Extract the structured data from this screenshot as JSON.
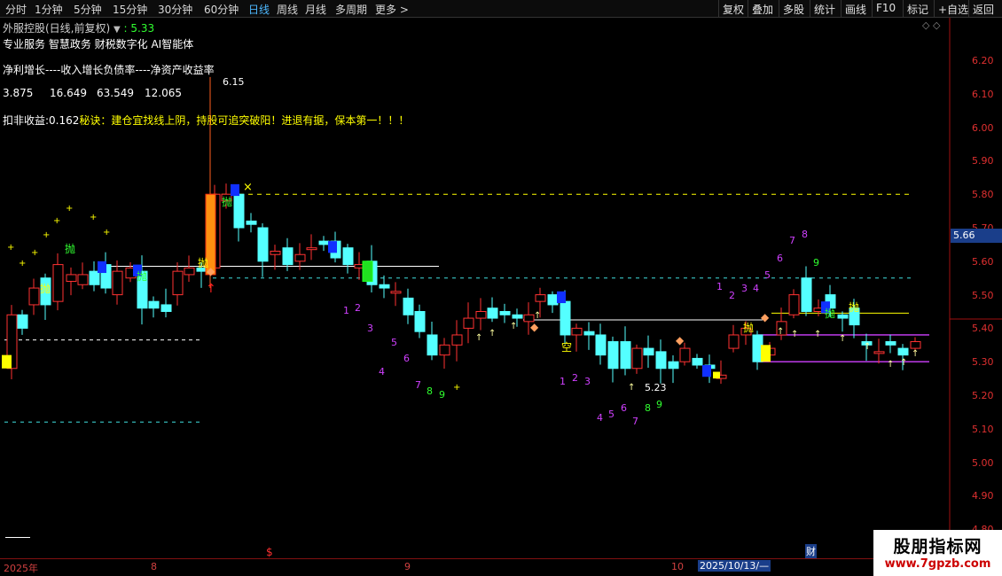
{
  "toolbar": {
    "tabs": [
      "分时",
      "1分钟",
      "5分钟",
      "15分钟",
      "30分钟",
      "60分钟",
      "日线",
      "周线",
      "月线",
      "多周期",
      "更多 >"
    ],
    "active": "日线",
    "right_buttons": [
      "复权",
      "叠加",
      "多股",
      "统计",
      "画线",
      "F10",
      "标记",
      "+自选",
      "返回"
    ]
  },
  "stock": {
    "name_line": "外服控股(日线,前复权)",
    "price_marker": "▼",
    "price": ": 5.33",
    "concepts": "专业服务  智慧政务  财税数字化  AI智能体"
  },
  "finance": {
    "header": "净利增长----收入增长负债率----净资产收益率",
    "values": [
      "3.875",
      "16.649",
      "63.549",
      "12.065"
    ],
    "deduct_label": "扣非收益:",
    "deduct_value": "0.162",
    "tip": "秘诀：建仓宜找线上阴，持股可追突破阳！进退有据，保本第一！！！"
  },
  "price_axis": {
    "ticks": [
      "6.20",
      "6.10",
      "6.00",
      "5.90",
      "5.80",
      "5.70",
      "5.60",
      "5.50",
      "5.40",
      "5.30",
      "5.20",
      "5.10",
      "5.00",
      "4.90",
      "4.80"
    ],
    "current": "5.66"
  },
  "annotations": {
    "high": "6.15",
    "low": "5.23",
    "sell": "抛",
    "empty": "空"
  },
  "date_axis": {
    "year": "2025年",
    "m8": "8",
    "m9": "9",
    "m10": "10",
    "cursor_date": "2025/10/13/—",
    "dollar": "$",
    "cai": "财"
  },
  "colors": {
    "up": "#ff3232",
    "down": "#54ffff",
    "ma_white": "#ffffff",
    "ma_purple": "#d040ff",
    "yellow": "#ffff00",
    "blue": "#1030ff"
  },
  "watermark": {
    "title": "股朋指标网",
    "url": "www.7gpzb.com"
  }
}
